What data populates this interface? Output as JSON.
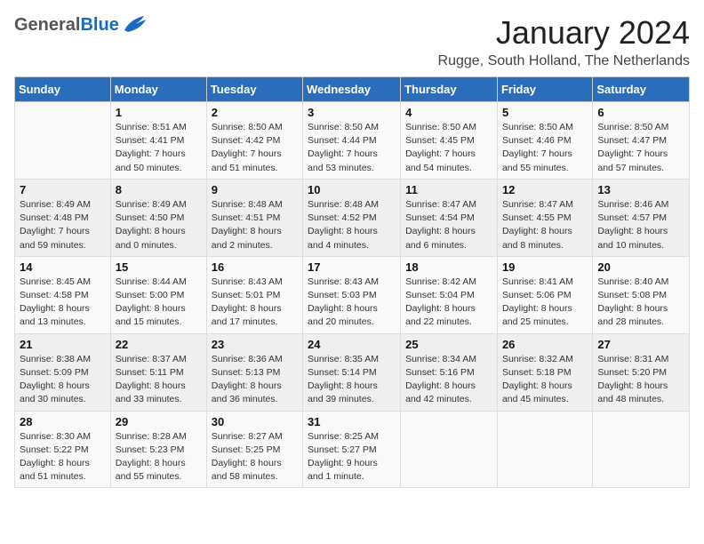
{
  "header": {
    "logo_general": "General",
    "logo_blue": "Blue",
    "month_title": "January 2024",
    "subtitle": "Rugge, South Holland, The Netherlands"
  },
  "columns": [
    "Sunday",
    "Monday",
    "Tuesday",
    "Wednesday",
    "Thursday",
    "Friday",
    "Saturday"
  ],
  "weeks": [
    [
      {
        "day": "",
        "info": ""
      },
      {
        "day": "1",
        "info": "Sunrise: 8:51 AM\nSunset: 4:41 PM\nDaylight: 7 hours\nand 50 minutes."
      },
      {
        "day": "2",
        "info": "Sunrise: 8:50 AM\nSunset: 4:42 PM\nDaylight: 7 hours\nand 51 minutes."
      },
      {
        "day": "3",
        "info": "Sunrise: 8:50 AM\nSunset: 4:44 PM\nDaylight: 7 hours\nand 53 minutes."
      },
      {
        "day": "4",
        "info": "Sunrise: 8:50 AM\nSunset: 4:45 PM\nDaylight: 7 hours\nand 54 minutes."
      },
      {
        "day": "5",
        "info": "Sunrise: 8:50 AM\nSunset: 4:46 PM\nDaylight: 7 hours\nand 55 minutes."
      },
      {
        "day": "6",
        "info": "Sunrise: 8:50 AM\nSunset: 4:47 PM\nDaylight: 7 hours\nand 57 minutes."
      }
    ],
    [
      {
        "day": "7",
        "info": "Sunrise: 8:49 AM\nSunset: 4:48 PM\nDaylight: 7 hours\nand 59 minutes."
      },
      {
        "day": "8",
        "info": "Sunrise: 8:49 AM\nSunset: 4:50 PM\nDaylight: 8 hours\nand 0 minutes."
      },
      {
        "day": "9",
        "info": "Sunrise: 8:48 AM\nSunset: 4:51 PM\nDaylight: 8 hours\nand 2 minutes."
      },
      {
        "day": "10",
        "info": "Sunrise: 8:48 AM\nSunset: 4:52 PM\nDaylight: 8 hours\nand 4 minutes."
      },
      {
        "day": "11",
        "info": "Sunrise: 8:47 AM\nSunset: 4:54 PM\nDaylight: 8 hours\nand 6 minutes."
      },
      {
        "day": "12",
        "info": "Sunrise: 8:47 AM\nSunset: 4:55 PM\nDaylight: 8 hours\nand 8 minutes."
      },
      {
        "day": "13",
        "info": "Sunrise: 8:46 AM\nSunset: 4:57 PM\nDaylight: 8 hours\nand 10 minutes."
      }
    ],
    [
      {
        "day": "14",
        "info": "Sunrise: 8:45 AM\nSunset: 4:58 PM\nDaylight: 8 hours\nand 13 minutes."
      },
      {
        "day": "15",
        "info": "Sunrise: 8:44 AM\nSunset: 5:00 PM\nDaylight: 8 hours\nand 15 minutes."
      },
      {
        "day": "16",
        "info": "Sunrise: 8:43 AM\nSunset: 5:01 PM\nDaylight: 8 hours\nand 17 minutes."
      },
      {
        "day": "17",
        "info": "Sunrise: 8:43 AM\nSunset: 5:03 PM\nDaylight: 8 hours\nand 20 minutes."
      },
      {
        "day": "18",
        "info": "Sunrise: 8:42 AM\nSunset: 5:04 PM\nDaylight: 8 hours\nand 22 minutes."
      },
      {
        "day": "19",
        "info": "Sunrise: 8:41 AM\nSunset: 5:06 PM\nDaylight: 8 hours\nand 25 minutes."
      },
      {
        "day": "20",
        "info": "Sunrise: 8:40 AM\nSunset: 5:08 PM\nDaylight: 8 hours\nand 28 minutes."
      }
    ],
    [
      {
        "day": "21",
        "info": "Sunrise: 8:38 AM\nSunset: 5:09 PM\nDaylight: 8 hours\nand 30 minutes."
      },
      {
        "day": "22",
        "info": "Sunrise: 8:37 AM\nSunset: 5:11 PM\nDaylight: 8 hours\nand 33 minutes."
      },
      {
        "day": "23",
        "info": "Sunrise: 8:36 AM\nSunset: 5:13 PM\nDaylight: 8 hours\nand 36 minutes."
      },
      {
        "day": "24",
        "info": "Sunrise: 8:35 AM\nSunset: 5:14 PM\nDaylight: 8 hours\nand 39 minutes."
      },
      {
        "day": "25",
        "info": "Sunrise: 8:34 AM\nSunset: 5:16 PM\nDaylight: 8 hours\nand 42 minutes."
      },
      {
        "day": "26",
        "info": "Sunrise: 8:32 AM\nSunset: 5:18 PM\nDaylight: 8 hours\nand 45 minutes."
      },
      {
        "day": "27",
        "info": "Sunrise: 8:31 AM\nSunset: 5:20 PM\nDaylight: 8 hours\nand 48 minutes."
      }
    ],
    [
      {
        "day": "28",
        "info": "Sunrise: 8:30 AM\nSunset: 5:22 PM\nDaylight: 8 hours\nand 51 minutes."
      },
      {
        "day": "29",
        "info": "Sunrise: 8:28 AM\nSunset: 5:23 PM\nDaylight: 8 hours\nand 55 minutes."
      },
      {
        "day": "30",
        "info": "Sunrise: 8:27 AM\nSunset: 5:25 PM\nDaylight: 8 hours\nand 58 minutes."
      },
      {
        "day": "31",
        "info": "Sunrise: 8:25 AM\nSunset: 5:27 PM\nDaylight: 9 hours\nand 1 minute."
      },
      {
        "day": "",
        "info": ""
      },
      {
        "day": "",
        "info": ""
      },
      {
        "day": "",
        "info": ""
      }
    ]
  ]
}
